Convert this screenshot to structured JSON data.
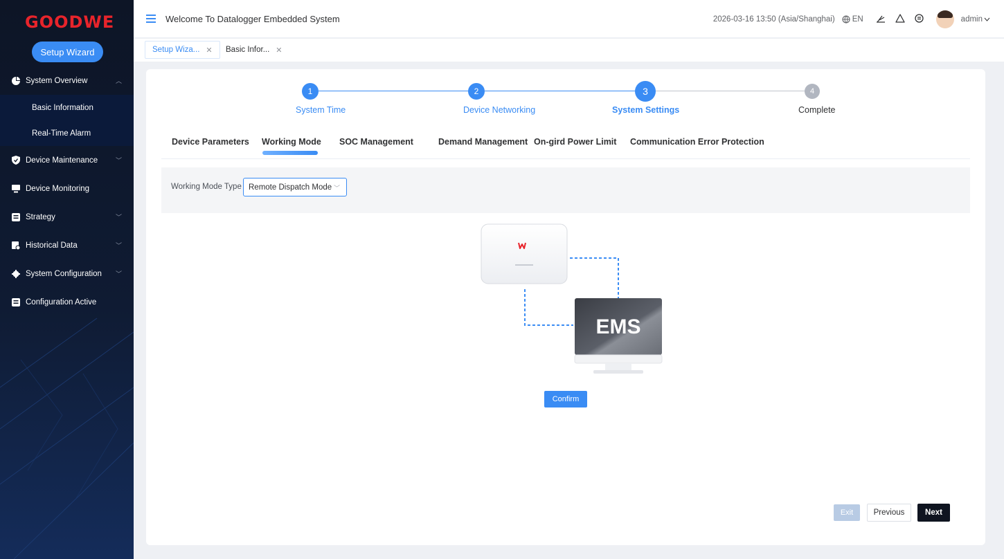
{
  "sidebar": {
    "logo": "GOODWE",
    "wizard_button": "Setup Wizard",
    "items": [
      {
        "label": "System Overview",
        "icon": "pie-chart-icon",
        "expanded": true
      },
      {
        "label": "Basic Information"
      },
      {
        "label": "Real-Time Alarm"
      },
      {
        "label": "Device Maintenance",
        "icon": "shield-icon"
      },
      {
        "label": "Device Monitoring",
        "icon": "monitor-icon"
      },
      {
        "label": "Strategy",
        "icon": "strategy-icon"
      },
      {
        "label": "Historical Data",
        "icon": "history-icon"
      },
      {
        "label": "System Configuration",
        "icon": "settings-icon"
      },
      {
        "label": "Configuration Active",
        "icon": "config-icon"
      }
    ]
  },
  "header": {
    "title": "Welcome To Datalogger Embedded System",
    "datetime": "2026-03-16 13:50 (Asia/Shanghai)",
    "language": "EN",
    "user": "admin"
  },
  "tabs": [
    {
      "label": "Setup Wiza...",
      "active": true
    },
    {
      "label": "Basic Infor...",
      "active": false
    }
  ],
  "steps": [
    {
      "number": "1",
      "label": "System Time"
    },
    {
      "number": "2",
      "label": "Device Networking"
    },
    {
      "number": "3",
      "label": "System Settings"
    },
    {
      "number": "4",
      "label": "Complete"
    }
  ],
  "subtabs": [
    "Device Parameters",
    "Working Mode",
    "SOC Management",
    "Demand Management",
    "On-gird Power Limit",
    "Communication Error Protection"
  ],
  "working_mode": {
    "label": "Working Mode Type",
    "value": "Remote Dispatch Mode"
  },
  "illustration": {
    "ems_label": "EMS",
    "confirm": "Confirm"
  },
  "footer": {
    "exit": "Exit",
    "previous": "Previous",
    "next": "Next"
  },
  "colors": {
    "accent": "#3a8cf4",
    "sidebar_bg": "#0d1526",
    "logo_red": "#e8242b",
    "next_bg": "#0f1420"
  }
}
